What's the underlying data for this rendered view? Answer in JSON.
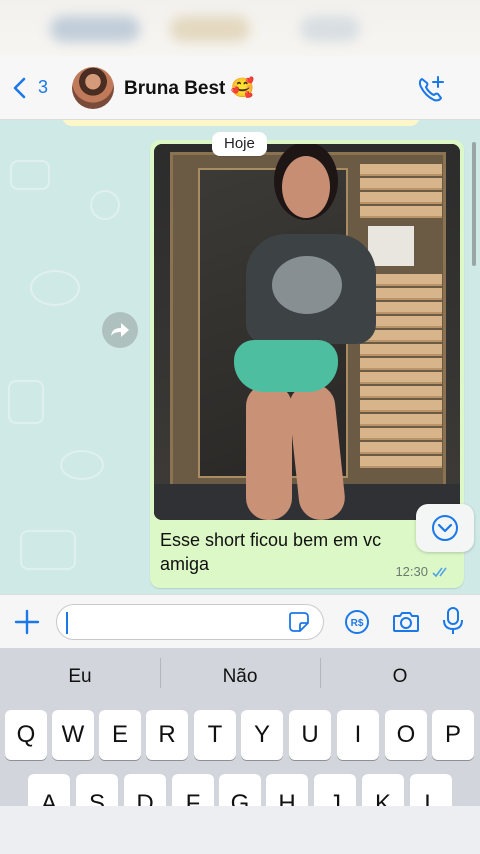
{
  "header": {
    "back_count": "3",
    "contact_name": "Bruna Best 🥰"
  },
  "chat": {
    "date_label": "Hoje",
    "message": {
      "text": "Esse short ficou bem em vc amiga",
      "time": "12:30",
      "status": "read"
    }
  },
  "input": {
    "value": "",
    "placeholder": ""
  },
  "keyboard": {
    "suggestions": [
      "Eu",
      "Não",
      "O"
    ],
    "row1": [
      "Q",
      "W",
      "E",
      "R",
      "T",
      "Y",
      "U",
      "I",
      "O",
      "P"
    ],
    "row2": [
      "A",
      "S",
      "D",
      "F",
      "G",
      "H",
      "J",
      "K",
      "L"
    ]
  },
  "colors": {
    "accent": "#1b78e8",
    "chat_bg": "#cfe9e6",
    "outgoing_bubble": "#dcf8c6",
    "read_ticks": "#53a4e6"
  },
  "icons": {
    "back": "chevron-left-icon",
    "call": "phone-plus-icon",
    "forward": "forward-arrow-icon",
    "scroll": "chevron-down-circle-icon",
    "plus": "plus-icon",
    "sticker": "sticker-icon",
    "pix": "pix-payment-icon",
    "camera": "camera-icon",
    "mic": "microphone-icon"
  }
}
